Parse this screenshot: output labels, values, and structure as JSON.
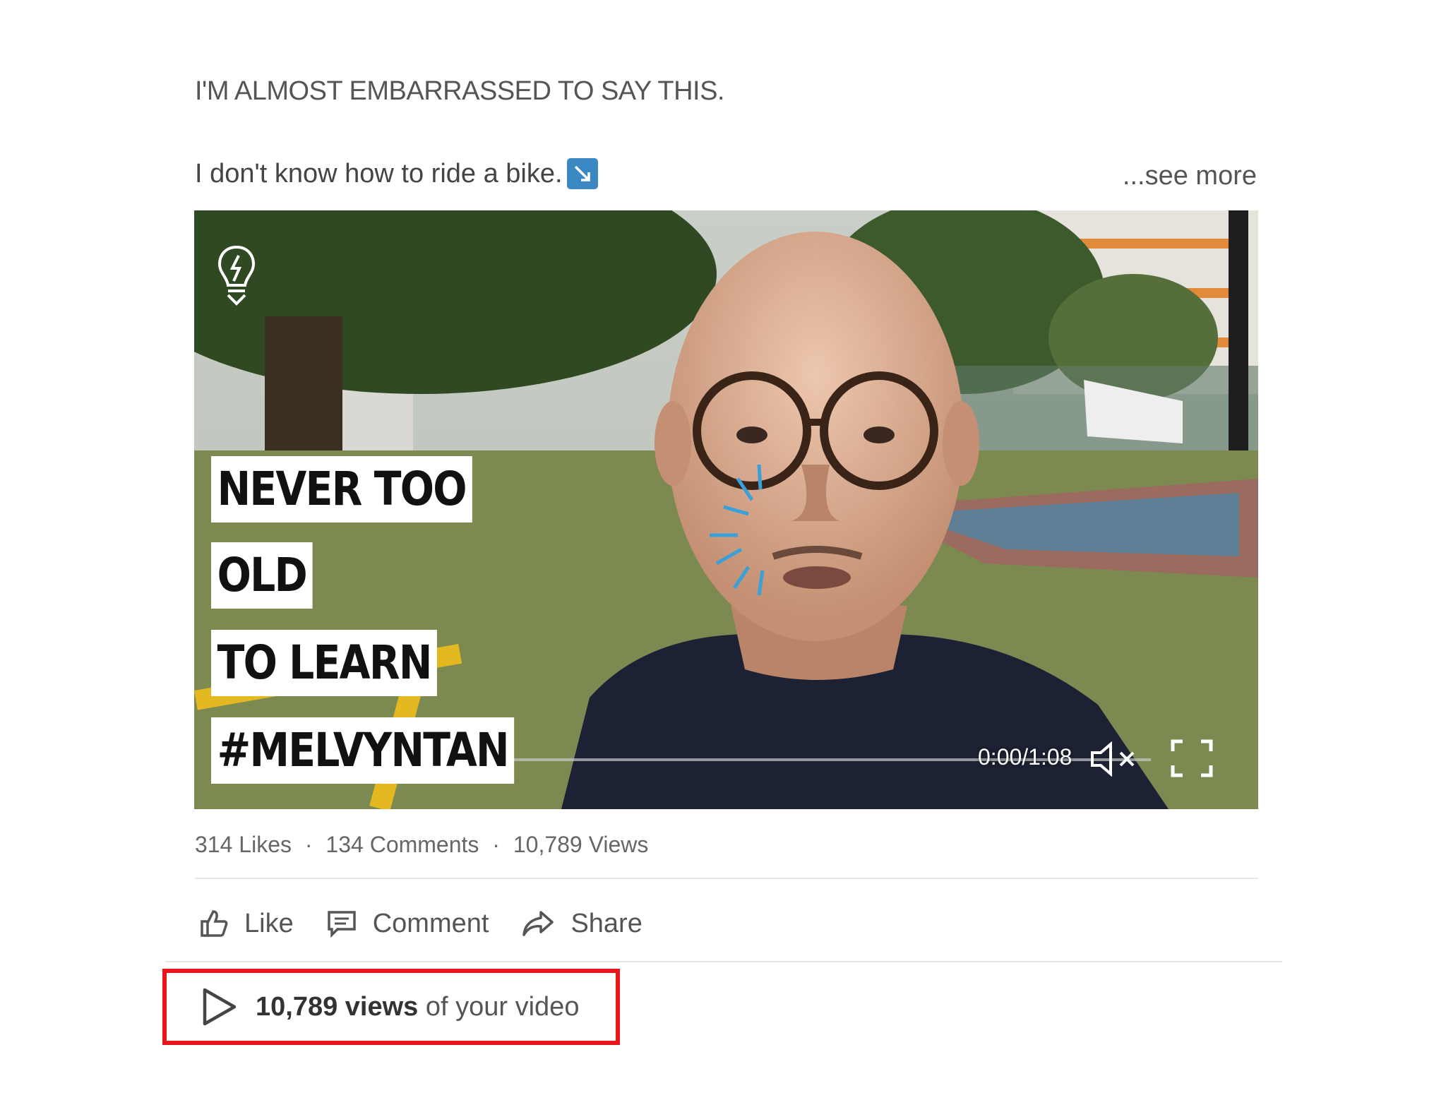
{
  "post": {
    "headline": "I'M ALMOST EMBARRASSED TO SAY THIS.",
    "body": "I don't know how to ride a bike.",
    "see_more": "...see more"
  },
  "video": {
    "overlay_lines": [
      "NEVER TOO",
      "OLD",
      "TO LEARN",
      "#MELVYNTAN"
    ],
    "time": "0:00/1:08",
    "muted": true
  },
  "stats": {
    "likes": "314 Likes",
    "comments": "134 Comments",
    "views": "10,789 Views",
    "separator": "·"
  },
  "actions": {
    "like": "Like",
    "comment": "Comment",
    "share": "Share"
  },
  "views_callout": {
    "count": "10,789 views",
    "suffix": "of your video",
    "highlight_color": "#e8151b"
  }
}
